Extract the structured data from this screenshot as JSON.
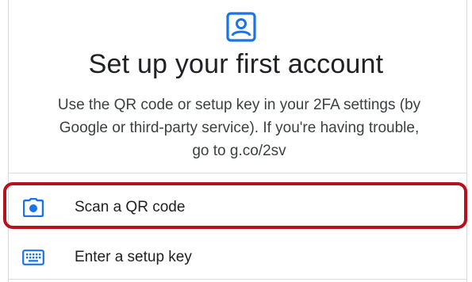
{
  "header": {
    "icon": "account-box-icon",
    "accent_color": "#1a73e8"
  },
  "title": "Set up your first account",
  "description": {
    "lines": [
      "Use the QR code or setup key in your 2FA settings (by",
      "Google or third-party service). If you're having trouble,",
      "go to g.co/2sv"
    ]
  },
  "options": [
    {
      "label": "Scan a QR code",
      "icon": "camera-icon",
      "highlighted": true,
      "highlight_color": "#b3121e"
    },
    {
      "label": "Enter a setup key",
      "icon": "keyboard-icon",
      "highlighted": false
    }
  ]
}
